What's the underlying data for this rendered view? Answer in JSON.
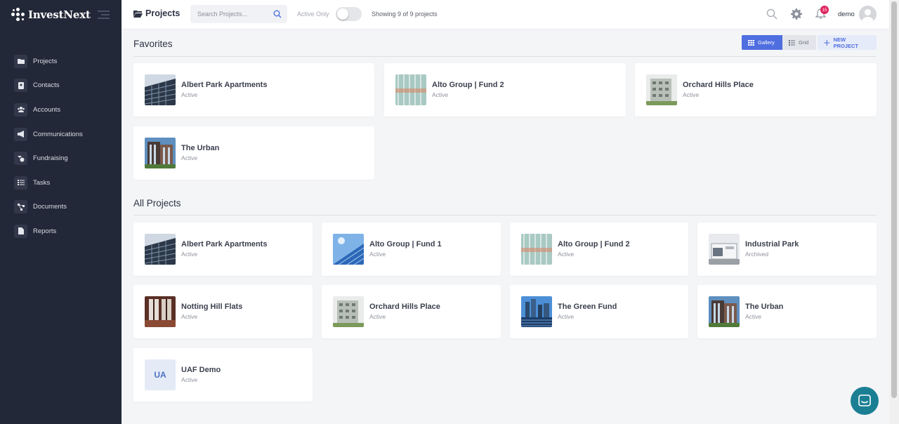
{
  "brand": {
    "name": "InvestNext"
  },
  "sidebar": {
    "items": [
      {
        "label": "Projects",
        "icon": "folder-icon"
      },
      {
        "label": "Contacts",
        "icon": "contact-card-icon"
      },
      {
        "label": "Accounts",
        "icon": "people-group-icon"
      },
      {
        "label": "Communications",
        "icon": "megaphone-icon"
      },
      {
        "label": "Fundraising",
        "icon": "fundraising-icon"
      },
      {
        "label": "Tasks",
        "icon": "checklist-icon"
      },
      {
        "label": "Documents",
        "icon": "sitemap-icon"
      },
      {
        "label": "Reports",
        "icon": "document-icon"
      }
    ]
  },
  "topbar": {
    "title": "Projects",
    "search_placeholder": "Search Projects...",
    "active_only_label": "Active Only",
    "showing_text": "Showing 9 of 9 projects",
    "notifications_count": "15",
    "username": "demo"
  },
  "view": {
    "gallery_label": "Gallery",
    "grid_label": "Grid",
    "new_project_label": "NEW PROJECT",
    "accent": "#4f6ee0"
  },
  "favorites": {
    "title": "Favorites",
    "cards": [
      {
        "name": "Albert Park Apartments",
        "status": "Active",
        "thumb": "office-glass"
      },
      {
        "name": "Alto Group | Fund 2",
        "status": "Active",
        "thumb": "warehouse"
      },
      {
        "name": "Orchard Hills Place",
        "status": "Active",
        "thumb": "apartment-gray"
      },
      {
        "name": "The Urban",
        "status": "Active",
        "thumb": "urban-building"
      }
    ]
  },
  "all_projects": {
    "title": "All Projects",
    "cards": [
      {
        "name": "Albert Park Apartments",
        "status": "Active",
        "thumb": "office-glass"
      },
      {
        "name": "Alto Group | Fund 1",
        "status": "Active",
        "thumb": "solar-sky"
      },
      {
        "name": "Alto Group | Fund 2",
        "status": "Active",
        "thumb": "warehouse"
      },
      {
        "name": "Industrial Park",
        "status": "Archived",
        "thumb": "industrial"
      },
      {
        "name": "Notting Hill Flats",
        "status": "Active",
        "thumb": "interior"
      },
      {
        "name": "Orchard Hills Place",
        "status": "Active",
        "thumb": "apartment-gray"
      },
      {
        "name": "The Green Fund",
        "status": "Active",
        "thumb": "city-solar"
      },
      {
        "name": "The Urban",
        "status": "Active",
        "thumb": "urban-building"
      },
      {
        "name": "UAF Demo",
        "status": "Active",
        "thumb": "initials",
        "initials": "UA"
      }
    ]
  }
}
